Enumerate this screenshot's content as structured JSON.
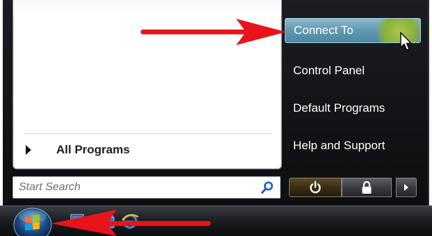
{
  "start_menu": {
    "left_pane": {
      "all_programs_label": "All Programs"
    },
    "search": {
      "placeholder": "Start Search",
      "icon": "search-icon"
    },
    "right_pane": {
      "items": [
        {
          "label": "Connect To",
          "highlighted": true
        },
        {
          "label": "Control Panel",
          "highlighted": false
        },
        {
          "label": "Default Programs",
          "highlighted": false
        },
        {
          "label": "Help and Support",
          "highlighted": false
        }
      ]
    },
    "power_controls": {
      "power_icon": "power-icon",
      "lock_icon": "lock-icon",
      "more_icon": "arrow-right-icon"
    }
  },
  "taskbar": {
    "start_icon": "windows-logo-icon",
    "quick_launch_icons": [
      "show-desktop-icon",
      "switch-windows-icon",
      "internet-explorer-icon"
    ]
  },
  "annotations": {
    "arrow_color": "#e8141b"
  },
  "colors": {
    "highlight": "#5f98b1",
    "menu_bg": "#16181b",
    "hover_glow": "#8ab13a"
  }
}
